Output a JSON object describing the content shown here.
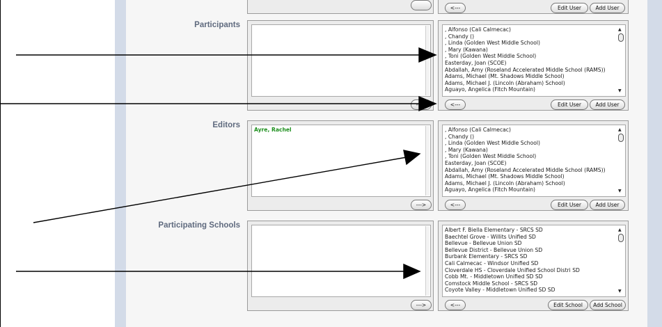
{
  "sections": {
    "participants": {
      "label": "Participants",
      "selected": [],
      "available": [
        ", Alfonso (Cali Calmecac)",
        ", Chandy ()",
        ", Linda (Golden West Middle School)",
        ", Mary (Kawana)",
        ", Toni (Golden West Middle School)",
        "Easterday, Joan (SCOE)",
        "Abdallah, Amy (Roseland Accelerated Middle School (RAMS))",
        "Adams, Michael (Mt. Shadows Middle School)",
        "Adams, Michael J. (Lincoln (Abraham) School)",
        "Aguayo, Angelica (Fitch Mountain)"
      ],
      "add_btn": "--->",
      "remove_btn": "<---",
      "edit_btn": "Edit User",
      "new_btn": "Add User"
    },
    "editors": {
      "label": "Editors",
      "selected": [
        "Ayre, Rachel"
      ],
      "available": [
        ", Alfonso (Cali Calmecac)",
        ", Chandy ()",
        ", Linda (Golden West Middle School)",
        ", Mary (Kawana)",
        ", Toni (Golden West Middle School)",
        "Easterday, Joan (SCOE)",
        "Abdallah, Amy (Roseland Accelerated Middle School (RAMS))",
        "Adams, Michael (Mt. Shadows Middle School)",
        "Adams, Michael J. (Lincoln (Abraham) School)",
        "Aguayo, Angelica (Fitch Mountain)"
      ],
      "add_btn": "--->",
      "remove_btn": "<---",
      "edit_btn": "Edit User",
      "new_btn": "Add User"
    },
    "schools": {
      "label": "Participating Schools",
      "selected": [],
      "available": [
        "Albert F. Biella Elementary - SRCS SD",
        "Baechtel Grove - Willits Unified SD",
        "Bellevue - Bellevue Union SD",
        "Bellevue District - Bellevue Union SD",
        "Burbank Elementary - SRCS SD",
        "Cali Calmecac - Windsor Unified SD",
        "Cloverdale HS - Cloverdale Unified School Distri SD",
        "Cobb Mt. - Middletown Unified SD SD",
        "Comstock Middle School - SRCS SD",
        "Coyote Valley - Middletown Unified SD SD"
      ],
      "add_btn": "--->",
      "remove_btn": "<---",
      "edit_btn": "Edit School",
      "new_btn": "Add School"
    }
  },
  "top_partial": {
    "remove_btn": "<---",
    "edit_btn": "Edit User",
    "new_btn": "Add User"
  }
}
